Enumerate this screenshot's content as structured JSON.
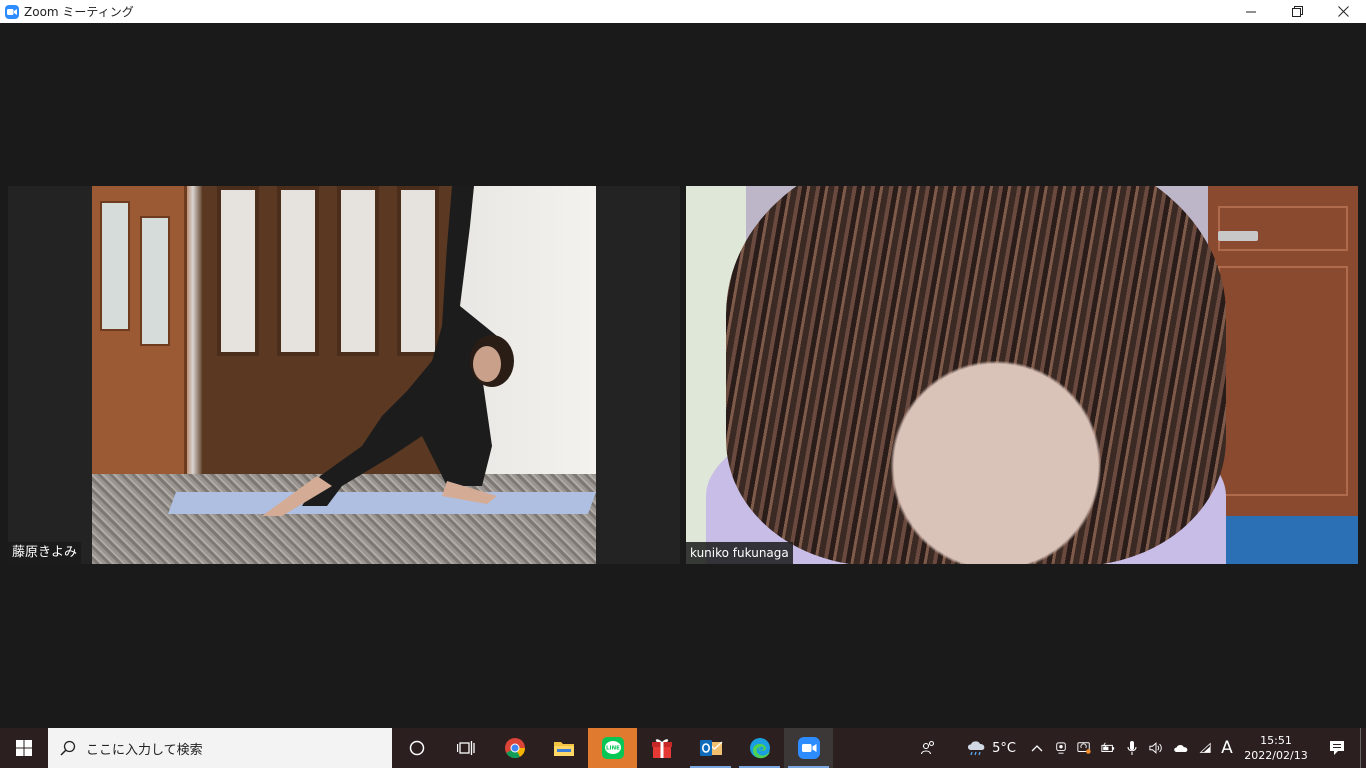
{
  "window": {
    "title": "Zoom ミーティング",
    "controls": {
      "minimize": "—",
      "restore": "❐",
      "close": "✕"
    }
  },
  "participants": [
    {
      "name": "藤原きよみ"
    },
    {
      "name": "kuniko fukunaga"
    }
  ],
  "taskbar": {
    "search_placeholder": "ここに入力して検索",
    "pinned": [
      "cortana",
      "task-view",
      "chrome",
      "file-explorer",
      "line",
      "gift",
      "outlook",
      "edge",
      "zoom"
    ],
    "weather_temp": "5°C",
    "language": "A",
    "time": "15:51",
    "date": "2022/02/13"
  },
  "colors": {
    "zoom_blue": "#2d8cff",
    "meeting_bg": "#1a1a1a",
    "taskbar_bg": "#2b1f1f",
    "line_green": "#06c755",
    "active_accent": "#7aa7e0"
  }
}
